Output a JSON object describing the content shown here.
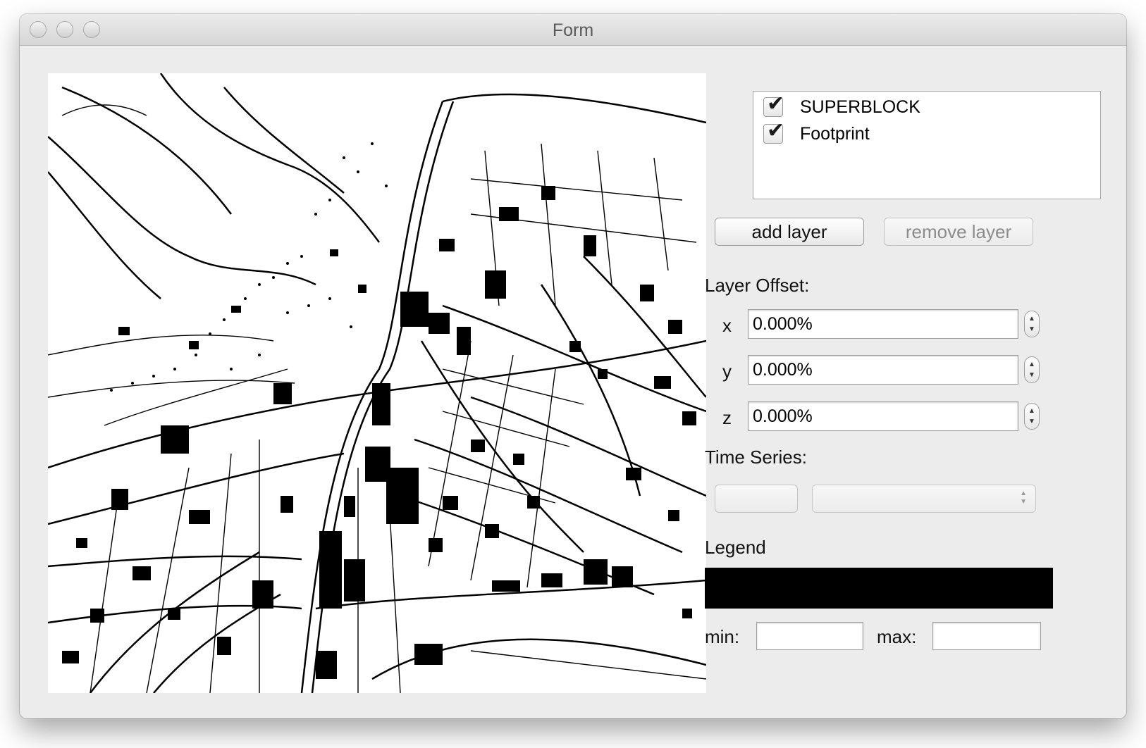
{
  "window": {
    "title": "Form"
  },
  "map": {
    "alt": "black and white city map"
  },
  "layers": {
    "items": [
      {
        "label": "SUPERBLOCK",
        "checked": true
      },
      {
        "label": "Footprint",
        "checked": true
      }
    ]
  },
  "buttons": {
    "add_layer": "add layer",
    "remove_layer": "remove layer"
  },
  "offset": {
    "heading": "Layer Offset:",
    "x_label": "x",
    "x_value": "0.000%",
    "y_label": "y",
    "y_value": "0.000%",
    "z_label": "z",
    "z_value": "0.000%"
  },
  "time_series": {
    "heading": "Time Series:",
    "button_label": "",
    "selected": ""
  },
  "legend": {
    "heading": "Legend",
    "color": "#000000",
    "min_label": "min:",
    "min_value": "",
    "max_label": "max:",
    "max_value": ""
  },
  "icons": {
    "check": "✔",
    "spin_up": "▲",
    "spin_down": "▼"
  }
}
